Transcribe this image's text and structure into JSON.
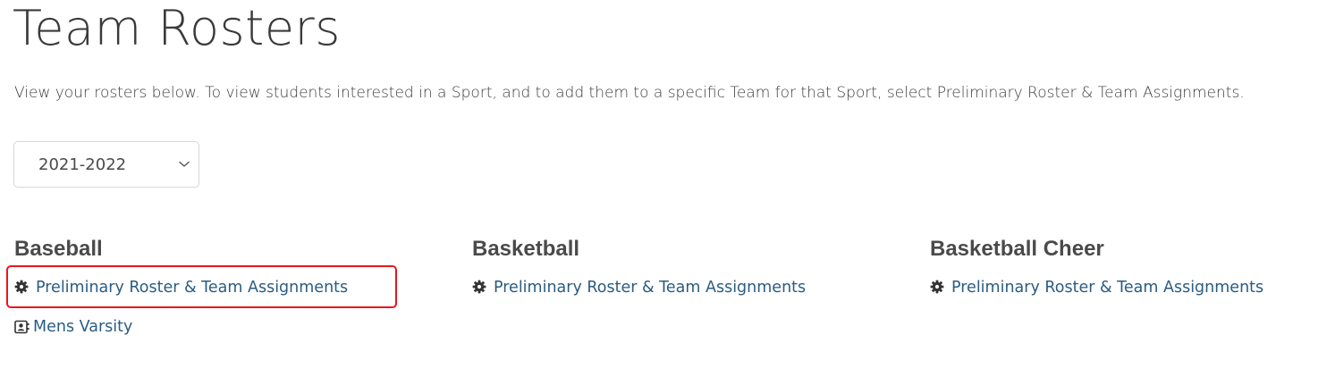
{
  "page": {
    "title": "Team Rosters",
    "intro": "View your rosters below. To view students interested in a Sport, and to add them to a specific Team for that Sport, select Preliminary Roster & Team Assignments."
  },
  "year_select": {
    "selected": "2021-2022"
  },
  "sports": [
    {
      "name": "Baseball",
      "prelim_link": "Preliminary Roster & Team Assignments",
      "teams": [
        "Mens Varsity"
      ]
    },
    {
      "name": "Basketball",
      "prelim_link": "Preliminary Roster & Team Assignments",
      "teams": []
    },
    {
      "name": "Basketball Cheer",
      "prelim_link": "Preliminary Roster & Team Assignments",
      "teams": []
    }
  ],
  "icons": {
    "prelim": "gear-icon",
    "team": "contact-card-icon",
    "dropdown": "chevron-down-icon"
  },
  "colors": {
    "link": "#2a5c82",
    "highlight": "#e8161c",
    "heading": "#4a4a4a"
  }
}
